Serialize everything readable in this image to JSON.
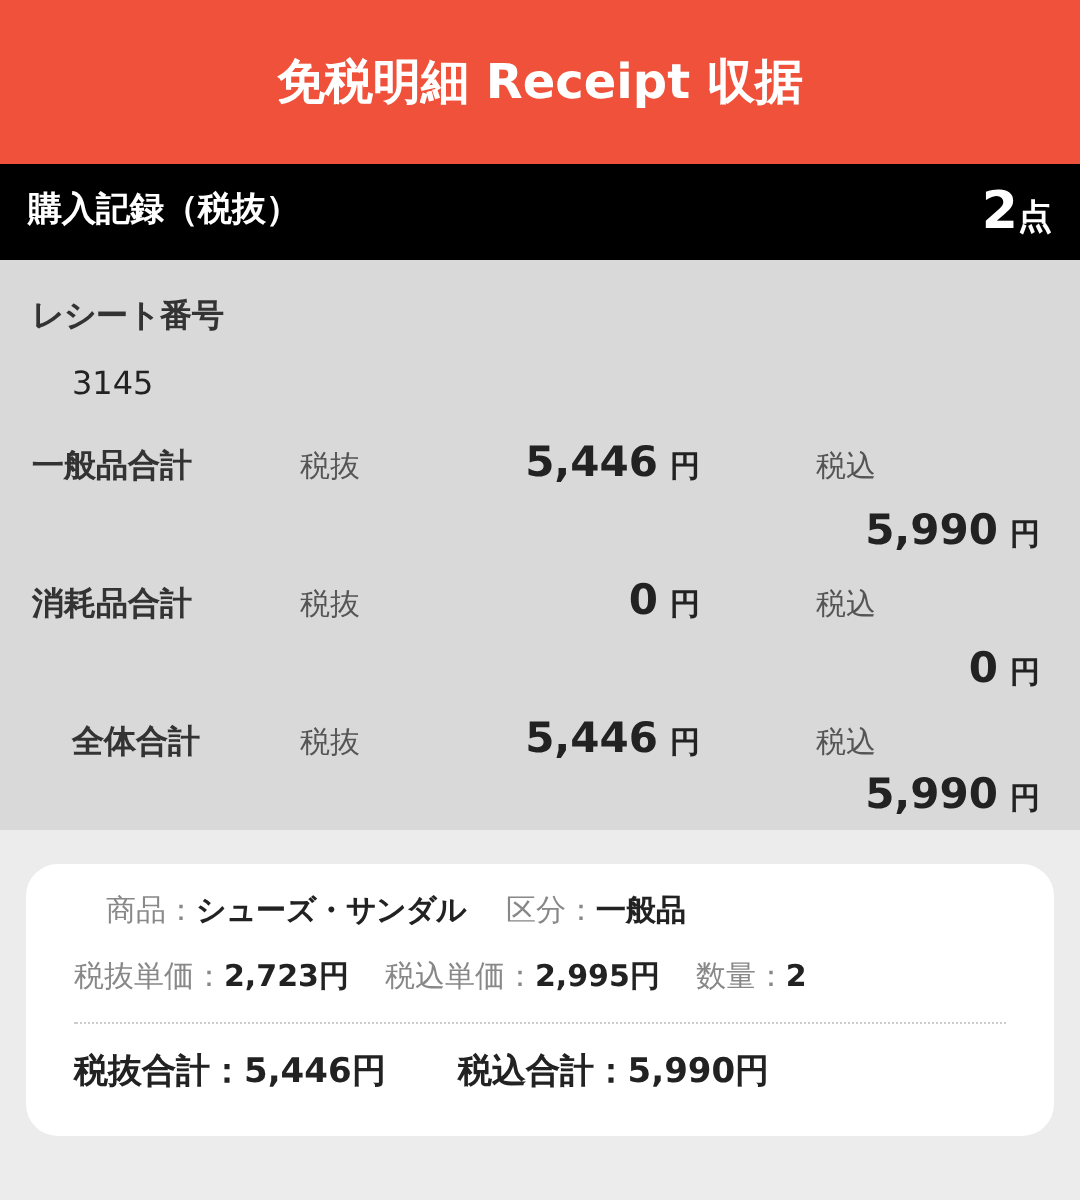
{
  "header": {
    "title": "免税明細 Receipt 収据"
  },
  "section_bar": {
    "title": "購入記録（税抜）",
    "count": "2",
    "unit": "点"
  },
  "receipt": {
    "label": "レシート番号",
    "number": "3145"
  },
  "totals": [
    {
      "label": "一般品合計",
      "indent": false,
      "excl_label": "税抜",
      "excl_amount": "5,446",
      "excl_unit": "円",
      "incl_label": "税込",
      "incl_amount": "5,990",
      "incl_unit": "円"
    },
    {
      "label": "消耗品合計",
      "indent": false,
      "excl_label": "税抜",
      "excl_amount": "0",
      "excl_unit": "円",
      "incl_label": "税込",
      "incl_amount": "0",
      "incl_unit": "円"
    },
    {
      "label": "全体合計",
      "indent": true,
      "excl_label": "税抜",
      "excl_amount": "5,446",
      "excl_unit": "円",
      "incl_label": "税込",
      "incl_amount": "5,990",
      "incl_unit": "円"
    }
  ],
  "item": {
    "product_label": "商品：",
    "product": "シューズ・サンダル",
    "category_label": "区分：",
    "category": "一般品",
    "unit_excl_label": "税抜単価：",
    "unit_excl": "2,723円",
    "unit_incl_label": "税込単価：",
    "unit_incl": "2,995円",
    "qty_label": "数量：",
    "qty": "2",
    "total_excl_label": "税抜合計：",
    "total_excl": "5,446円",
    "total_incl_label": "税込合計：",
    "total_incl": "5,990円"
  }
}
